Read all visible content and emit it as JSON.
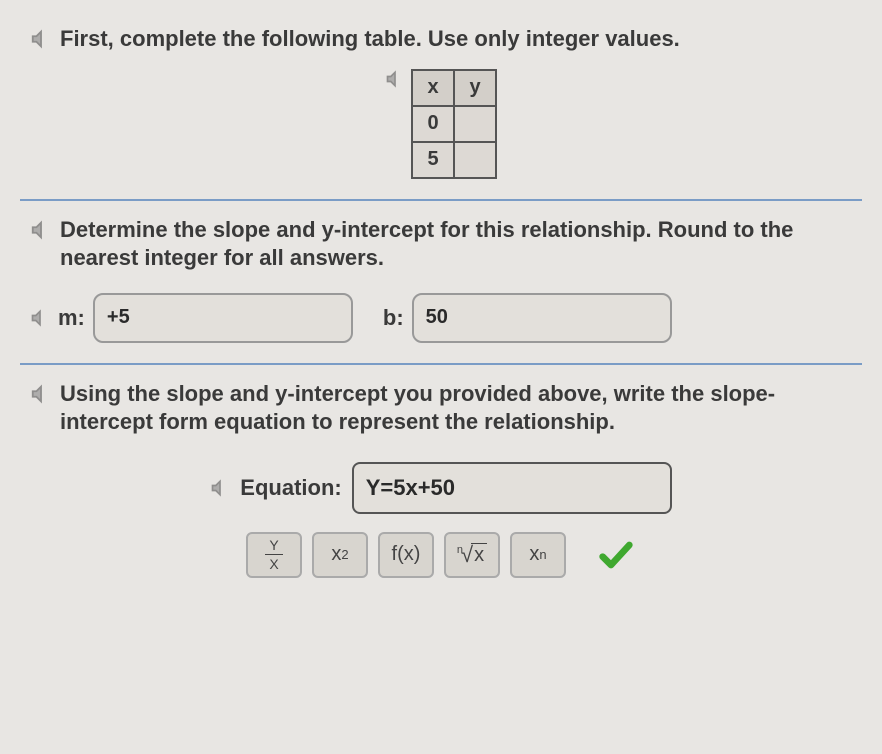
{
  "section1": {
    "instruction": "First, complete the following table. Use only integer values.",
    "table": {
      "headers": {
        "x": "x",
        "y": "y"
      },
      "rows": [
        {
          "x": "0",
          "y": ""
        },
        {
          "x": "5",
          "y": ""
        }
      ]
    }
  },
  "section2": {
    "instruction": "Determine the slope and y-intercept for this relationship. Round to the nearest integer for all answers.",
    "m_label": "m:",
    "m_value": "+5",
    "b_label": "b:",
    "b_value": "50"
  },
  "section3": {
    "instruction": "Using the slope and y-intercept you provided above, write the slope-intercept form equation to represent the relationship.",
    "equation_label": "Equation:",
    "equation_value": "Y=5x+50"
  },
  "toolbar": {
    "fraction_num": "Y",
    "fraction_den": "X",
    "power_base": "x",
    "power_exp": "2",
    "function_label": "f(x)",
    "root_index": "n",
    "root_radicand": "x",
    "sub_base": "x",
    "sub_index": "n"
  }
}
